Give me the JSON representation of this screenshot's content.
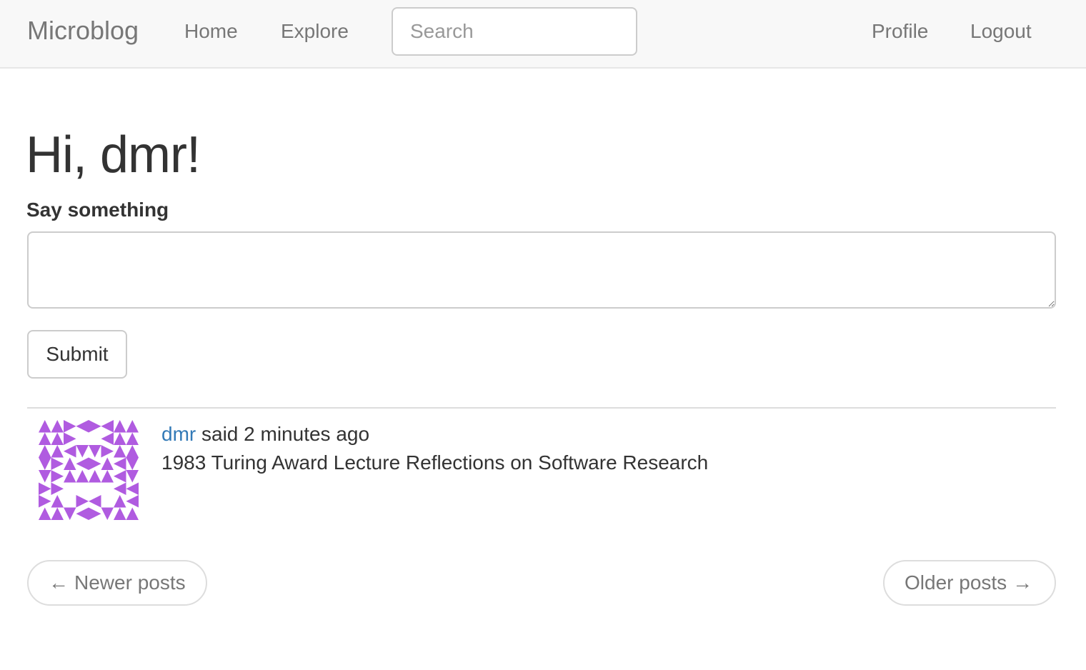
{
  "navbar": {
    "brand": "Microblog",
    "home_label": "Home",
    "explore_label": "Explore",
    "search_placeholder": "Search",
    "profile_label": "Profile",
    "logout_label": "Logout"
  },
  "main": {
    "greeting": "Hi, dmr!",
    "form_label": "Say something",
    "textarea_value": "",
    "submit_label": "Submit"
  },
  "post": {
    "author": "dmr",
    "said_text": "said 2 minutes ago",
    "body": "1983 Turing Award Lecture Reflections on Software Research",
    "avatar_color": "#b05be0"
  },
  "pager": {
    "newer_label": "Newer posts",
    "newer_arrow": "←",
    "older_label": "Older posts",
    "older_arrow": "→"
  },
  "colors": {
    "link": "#337ab7",
    "nav_text": "#777777",
    "navbar_bg": "#f8f8f8"
  }
}
